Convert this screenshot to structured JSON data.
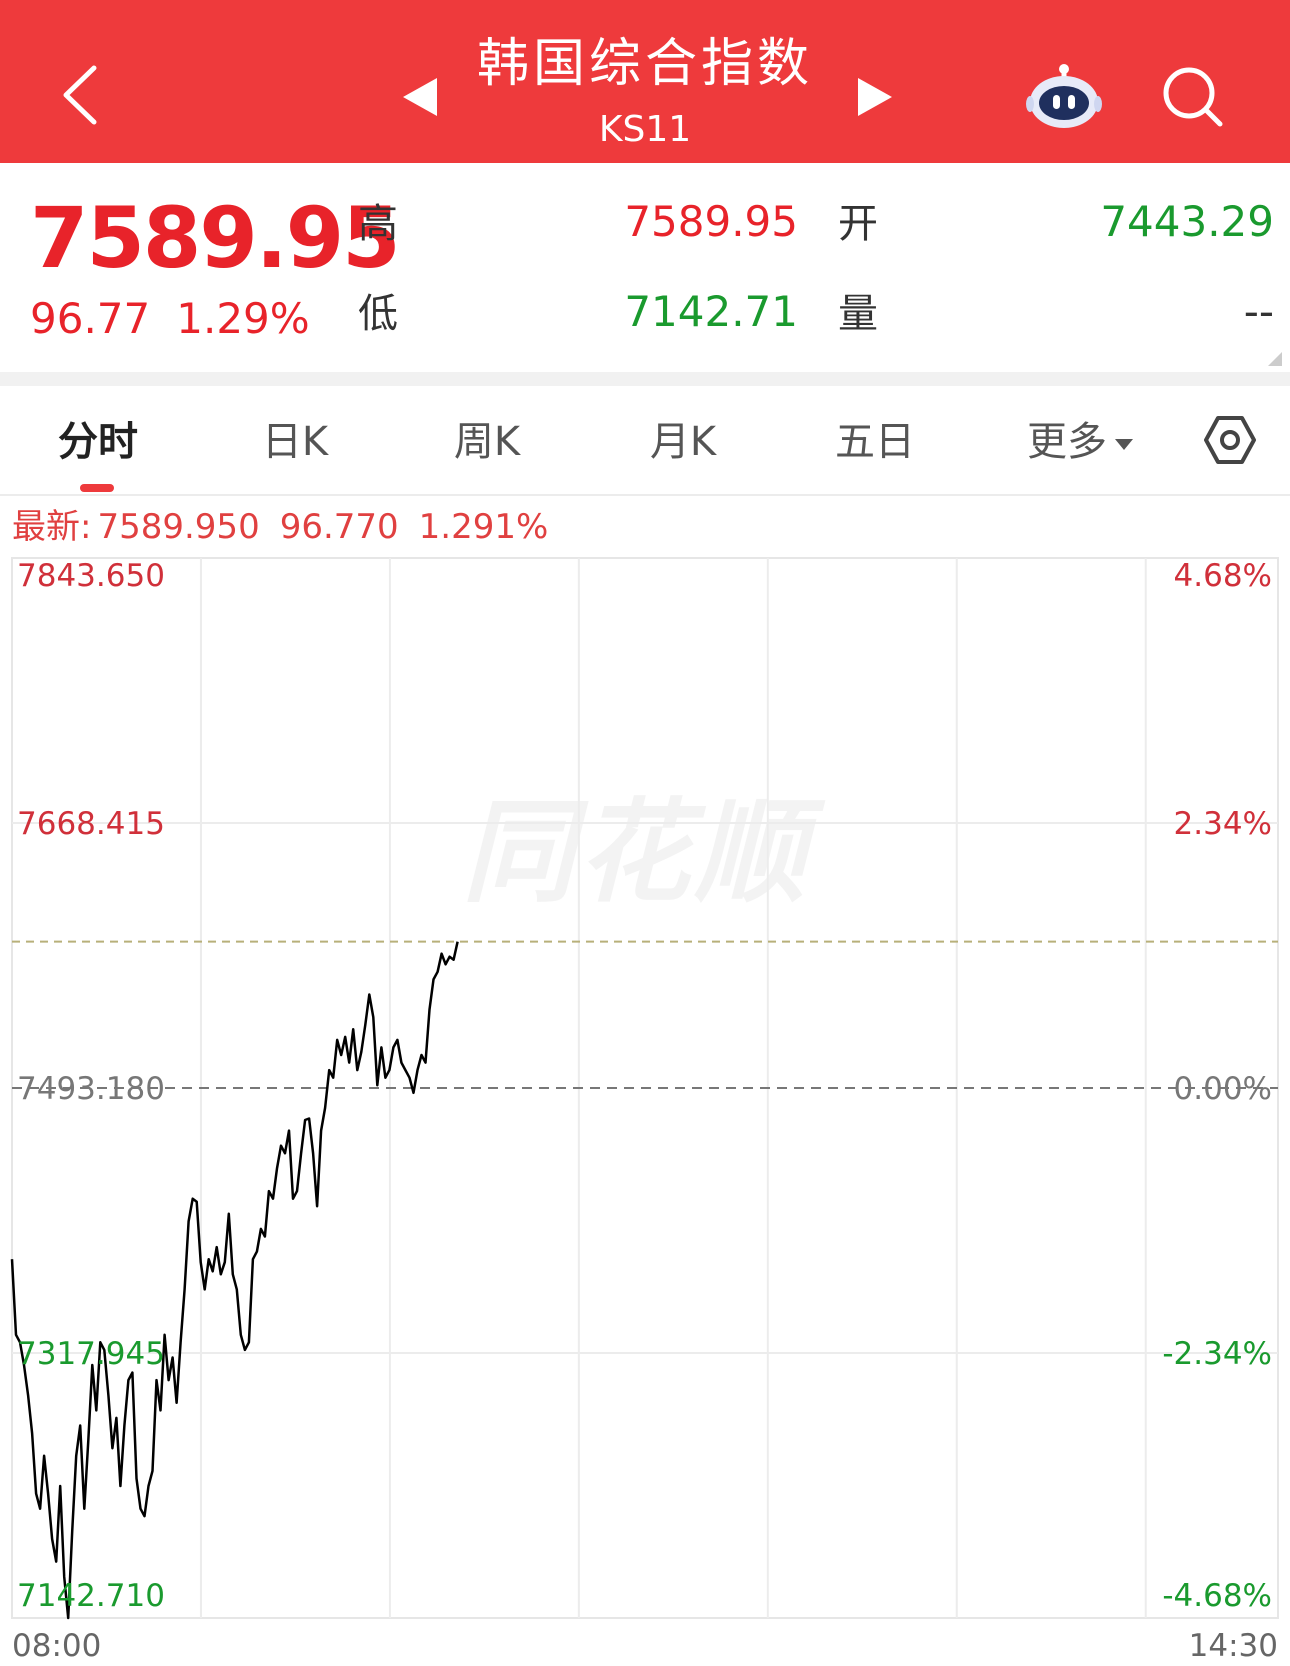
{
  "header": {
    "title": "韩国综合指数",
    "code": "KS11",
    "icons": [
      "back-icon",
      "prev-triangle-icon",
      "next-triangle-icon",
      "robot-assistant-icon",
      "search-icon"
    ]
  },
  "quote": {
    "price": "7589.95",
    "change": "96.77",
    "change_pct": "1.29%",
    "high_label": "高",
    "high": "7589.95",
    "open_label": "开",
    "open": "7443.29",
    "low_label": "低",
    "low": "7142.71",
    "volume_label": "量",
    "volume": "--"
  },
  "tabs": [
    {
      "label": "分时",
      "active": true
    },
    {
      "label": "日K",
      "active": false
    },
    {
      "label": "周K",
      "active": false
    },
    {
      "label": "月K",
      "active": false
    },
    {
      "label": "五日",
      "active": false
    },
    {
      "label": "更多",
      "active": false
    }
  ],
  "latest": {
    "label": "最新:",
    "price": "7589.950",
    "change": "96.770",
    "pct": "1.291%"
  },
  "watermark": "同花顺",
  "colors": {
    "header": "#ee3a3c",
    "up": "#e8232a",
    "down": "#1a9a2e",
    "line": "#000000"
  },
  "chart_data": {
    "type": "line",
    "y_labels": [
      "7843.650",
      "7668.415",
      "7493.180",
      "7317.945",
      "7142.710"
    ],
    "pct_labels": [
      "4.68%",
      "2.34%",
      "0.00%",
      "-2.34%",
      "-4.68%"
    ],
    "x_start": "08:00",
    "x_end": "14:30",
    "ylim": [
      7142.71,
      7843.65
    ],
    "prev_close": 7493.18,
    "latest": 7589.95,
    "series": [
      {
        "values": [
          7380,
          7330,
          7325,
          7310,
          7290,
          7265,
          7225,
          7215,
          7250,
          7225,
          7195,
          7180,
          7230,
          7170,
          7142.71,
          7200,
          7250,
          7270,
          7215,
          7260,
          7310,
          7280,
          7325,
          7320,
          7290,
          7255,
          7275,
          7230,
          7270,
          7300,
          7305,
          7235,
          7215,
          7210,
          7230,
          7240,
          7300,
          7280,
          7330,
          7300,
          7315,
          7285,
          7325,
          7360,
          7405,
          7420,
          7418,
          7378,
          7360,
          7380,
          7372,
          7388,
          7370,
          7378,
          7410,
          7370,
          7360,
          7330,
          7320,
          7325,
          7380,
          7385,
          7400,
          7395,
          7425,
          7420,
          7440,
          7455,
          7450,
          7465,
          7420,
          7425,
          7450,
          7472,
          7473,
          7450,
          7415,
          7465,
          7480,
          7505,
          7500,
          7525,
          7515,
          7527,
          7510,
          7532,
          7505,
          7517,
          7535,
          7555,
          7540,
          7495,
          7520,
          7500,
          7505,
          7520,
          7525,
          7510,
          7505,
          7500,
          7490,
          7505,
          7515,
          7510,
          7545,
          7565,
          7570,
          7582,
          7575,
          7580,
          7578,
          7589.95
        ],
        "points_total": 390
      }
    ]
  }
}
